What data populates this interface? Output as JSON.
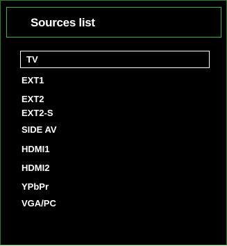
{
  "header": {
    "title": "Sources list"
  },
  "sources": {
    "items": [
      {
        "label": "TV",
        "selected": true
      },
      {
        "label": "EXT1",
        "selected": false
      },
      {
        "label": "EXT2",
        "selected": false
      },
      {
        "label": "EXT2-S",
        "selected": false
      },
      {
        "label": "SIDE AV",
        "selected": false
      },
      {
        "label": "HDMI1",
        "selected": false
      },
      {
        "label": "HDMI2",
        "selected": false
      },
      {
        "label": "YPbPr",
        "selected": false
      },
      {
        "label": "VGA/PC",
        "selected": false
      }
    ]
  },
  "colors": {
    "background": "#000000",
    "frame_border": "#3cb043",
    "text": "#ffffff",
    "selection_border": "#ffffff"
  }
}
